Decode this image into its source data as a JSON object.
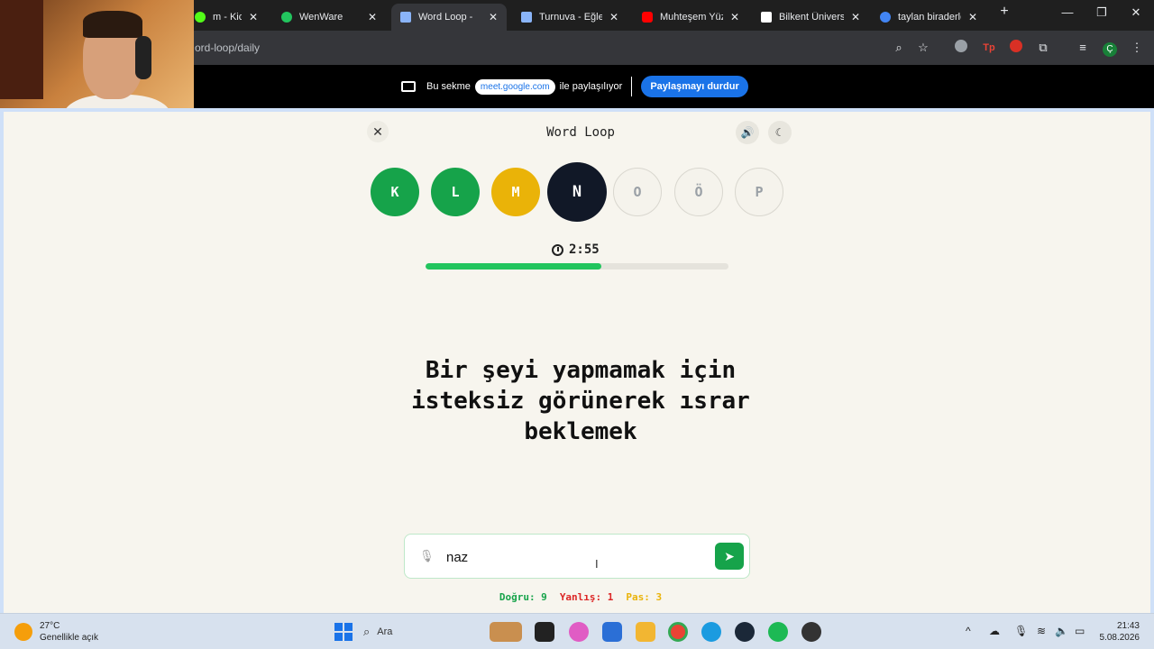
{
  "browser": {
    "tabs": [
      {
        "title": "m - Kick Da",
        "close": "✕",
        "color": "#53fc18"
      },
      {
        "title": "WenWare",
        "close": "✕",
        "color": "#22c55e"
      },
      {
        "title": "Word Loop -",
        "close": "✕",
        "color": "#8ab4f8",
        "active": true
      },
      {
        "title": "Turnuva - Eğlenc",
        "close": "✕",
        "color": "#8ab4f8"
      },
      {
        "title": "Muhteşem Yüzy",
        "close": "✕",
        "color": "#ff0000"
      },
      {
        "title": "Bilkent Üniversit",
        "close": "✕",
        "color": "#ffffff"
      },
      {
        "title": "taylan biraderler",
        "close": "✕",
        "color": "#4285f4"
      }
    ],
    "new_tab": "+",
    "window_controls": {
      "minimize": "—",
      "restore": "❐",
      "close": "✕"
    },
    "url": "ord-loop/daily",
    "toolbar_icons": [
      "zoom-icon",
      "star-icon",
      "grammarly-icon",
      "extension-icon",
      "extension-icon",
      "puzzle-icon",
      "media-icon",
      "profile-icon",
      "menu-icon"
    ],
    "profile_initial": "Ç"
  },
  "share_banner": {
    "prefix": "Bu sekme",
    "domain": "meet.google.com",
    "suffix": "ile paylaşılıyor",
    "stop_label": "Paylaşmayı durdur"
  },
  "game": {
    "title": "Word Loop",
    "close_icon": "✕",
    "sound_icon": "🔊",
    "theme_icon": "☾",
    "letters": [
      {
        "char": "K",
        "state": "done"
      },
      {
        "char": "L",
        "state": "done"
      },
      {
        "char": "M",
        "state": "pass"
      },
      {
        "char": "N",
        "state": "current"
      },
      {
        "char": "O",
        "state": "pending"
      },
      {
        "char": "Ö",
        "state": "pending"
      },
      {
        "char": "P",
        "state": "pending"
      }
    ],
    "timer": "2:55",
    "progress_fraction": 0.58,
    "clue": "Bir şeyi yapmamak için isteksiz görünerek ısrar beklemek",
    "answer_value": "naz",
    "send_icon": "➤",
    "stats": {
      "correct": "Doğru: 9",
      "wrong": "Yanlış: 1",
      "pass": "Pas: 3"
    }
  },
  "taskbar": {
    "weather_temp": "27°C",
    "weather_desc": "Genellikle açık",
    "search_label": "Ara",
    "time": "21:43",
    "date": "5.08.2026"
  }
}
